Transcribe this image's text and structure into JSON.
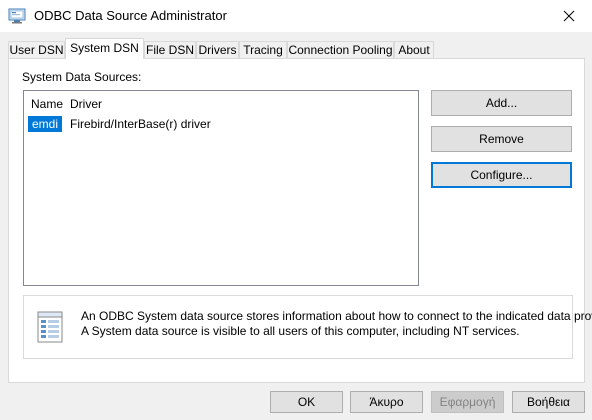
{
  "window": {
    "title": "ODBC Data Source Administrator",
    "close_glyph": "✕"
  },
  "tabs": [
    {
      "label": "User DSN",
      "active": false
    },
    {
      "label": "System DSN",
      "active": true
    },
    {
      "label": "File DSN",
      "active": false
    },
    {
      "label": "Drivers",
      "active": false
    },
    {
      "label": "Tracing",
      "active": false
    },
    {
      "label": "Connection Pooling",
      "active": false
    },
    {
      "label": "About",
      "active": false
    }
  ],
  "system_dsn": {
    "section_label": "System Data Sources:",
    "columns": [
      "Name",
      "Driver"
    ],
    "rows": [
      {
        "name": "emdi",
        "driver": "Firebird/InterBase(r) driver",
        "selected": true
      }
    ],
    "buttons": {
      "add": "Add...",
      "remove": "Remove",
      "configure": "Configure..."
    },
    "info": {
      "line1": "An ODBC System data source stores information about how to connect to the indicated data provider.",
      "line2": "A System data source is visible to all users of this computer, including NT services.",
      "icon": "database-document-icon"
    }
  },
  "footer": {
    "ok": "OK",
    "cancel": "Άκυρο",
    "apply": "Εφαρμογή",
    "help": "Βοήθεια"
  },
  "colors": {
    "selection": "#0078d7",
    "focus_border": "#0078d7"
  }
}
